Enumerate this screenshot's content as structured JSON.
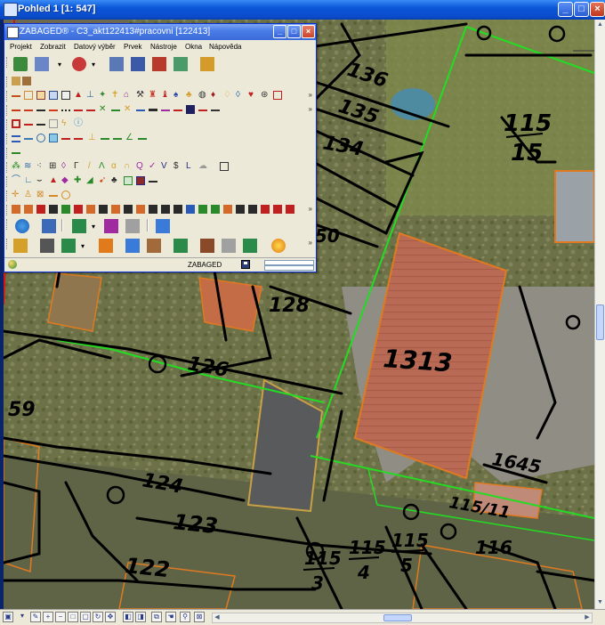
{
  "view_window": {
    "title": "Pohled 1 [1: 547]",
    "controls": {
      "minimize": "_",
      "maximize": "□",
      "close": "×"
    }
  },
  "map": {
    "parcel_labels": [
      {
        "text": "136",
        "kind": "parcel-number"
      },
      {
        "text": "135",
        "kind": "parcel-number"
      },
      {
        "text": "134",
        "kind": "parcel-number"
      },
      {
        "text": "115",
        "kind": "fraction-top"
      },
      {
        "text": "15",
        "kind": "fraction-bottom"
      },
      {
        "text": "128",
        "kind": "parcel-number"
      },
      {
        "text": "126",
        "kind": "parcel-number"
      },
      {
        "text": "1313",
        "kind": "parcel-number"
      },
      {
        "text": "1645",
        "kind": "parcel-number"
      },
      {
        "text": "59",
        "kind": "parcel-number"
      },
      {
        "text": "124",
        "kind": "parcel-number"
      },
      {
        "text": "123",
        "kind": "parcel-number"
      },
      {
        "text": "122",
        "kind": "parcel-number"
      },
      {
        "text": "115",
        "kind": "fraction-top"
      },
      {
        "text": "3",
        "kind": "fraction-bottom"
      },
      {
        "text": "115",
        "kind": "fraction-top"
      },
      {
        "text": "4",
        "kind": "fraction-bottom"
      },
      {
        "text": "115",
        "kind": "fraction-top"
      },
      {
        "text": "5",
        "kind": "fraction-bottom"
      },
      {
        "text": "116",
        "kind": "parcel-number"
      },
      {
        "text": "115/11",
        "kind": "parcel-number"
      },
      {
        "text": "50",
        "kind": "parcel-number"
      }
    ]
  },
  "zabaged_window": {
    "title": "ZABAGED® - C3_akt122413#pracovni [122413]",
    "controls": {
      "minimize": "_",
      "maximize": "□",
      "close": "×"
    },
    "menu": [
      "Projekt",
      "Zobrazit",
      "Datový výběr",
      "Prvek",
      "Nástroje",
      "Okna",
      "Nápověda"
    ],
    "status": {
      "layer": "ZABAGED"
    }
  },
  "colors": {
    "titlebar": "#0a4ccc",
    "parcel_line": "#000000",
    "boundary_green": "#22dd22",
    "building_outline": "#e07a20",
    "roof_red": "#b46550"
  }
}
